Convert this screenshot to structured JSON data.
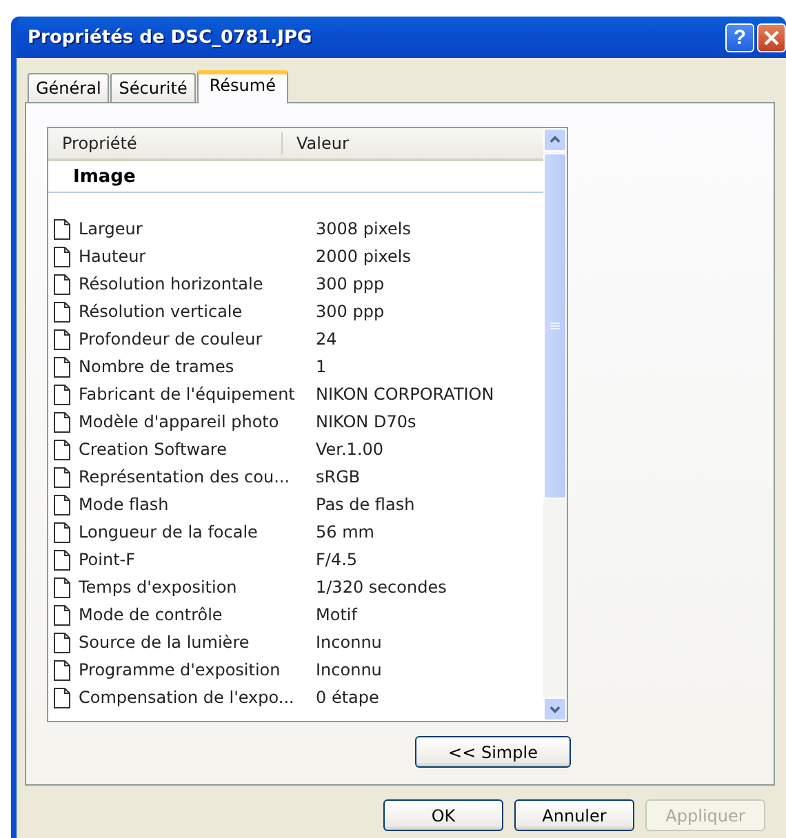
{
  "window": {
    "title": "Propriétés de DSC_0781.JPG",
    "help_button": "?"
  },
  "tabs": [
    {
      "label": "Général",
      "selected": false
    },
    {
      "label": "Sécurité",
      "selected": false
    },
    {
      "label": "Résumé",
      "selected": true
    }
  ],
  "list": {
    "columns": [
      "Propriété",
      "Valeur"
    ],
    "group": "Image",
    "rows": [
      {
        "property": "Largeur",
        "value": "3008 pixels"
      },
      {
        "property": "Hauteur",
        "value": "2000 pixels"
      },
      {
        "property": "Résolution horizontale",
        "value": "300 ppp"
      },
      {
        "property": "Résolution verticale",
        "value": "300 ppp"
      },
      {
        "property": "Profondeur de couleur",
        "value": "24"
      },
      {
        "property": "Nombre de trames",
        "value": "1"
      },
      {
        "property": "Fabricant de l'équipement",
        "value": "NIKON CORPORATION"
      },
      {
        "property": "Modèle d'appareil photo",
        "value": "NIKON D70s"
      },
      {
        "property": "Creation Software",
        "value": "Ver.1.00"
      },
      {
        "property": "Représentation des cou...",
        "value": "sRGB"
      },
      {
        "property": "Mode flash",
        "value": "Pas de flash"
      },
      {
        "property": "Longueur de la focale",
        "value": "56 mm"
      },
      {
        "property": "Point-F",
        "value": "F/4.5"
      },
      {
        "property": "Temps d'exposition",
        "value": "1/320 secondes"
      },
      {
        "property": "Mode de contrôle",
        "value": "Motif"
      },
      {
        "property": "Source de la lumière",
        "value": "Inconnu"
      },
      {
        "property": "Programme d'exposition",
        "value": "Inconnu"
      },
      {
        "property": "Compensation de l'expo...",
        "value": "0 étape"
      }
    ]
  },
  "simple_button": "<< Simple",
  "buttons": [
    {
      "label": "OK",
      "disabled": false
    },
    {
      "label": "Annuler",
      "disabled": false
    },
    {
      "label": "Appliquer",
      "disabled": true
    }
  ]
}
